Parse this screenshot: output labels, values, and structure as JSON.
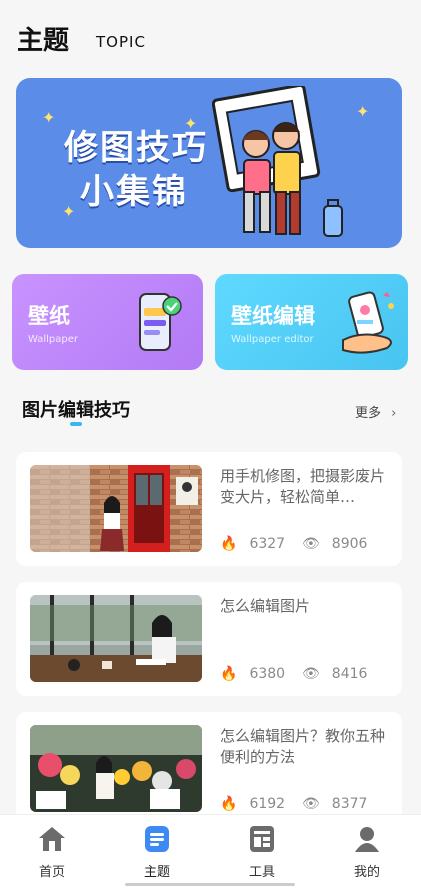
{
  "header": {
    "title": "主题",
    "subtitle": "TOPIC"
  },
  "banner": {
    "line1": "修图技巧",
    "line2": "小集锦"
  },
  "cards": [
    {
      "title": "壁纸",
      "subtitle": "Wallpaper",
      "color": "#b97ef7"
    },
    {
      "title": "壁纸编辑",
      "subtitle": "Wallpaper editor",
      "color": "#4fcaf3"
    }
  ],
  "section": {
    "title": "图片编辑技巧",
    "more": "更多"
  },
  "articles": [
    {
      "title": "用手机修图，把摄影废片变大片，轻松简单…",
      "likes": "6327",
      "views": "8906"
    },
    {
      "title": "怎么编辑图片",
      "likes": "6380",
      "views": "8416"
    },
    {
      "title": "怎么编辑图片？教你五种便利的方法",
      "likes": "6192",
      "views": "8377"
    }
  ],
  "tabs": [
    {
      "label": "首页",
      "icon": "home-icon"
    },
    {
      "label": "主题",
      "icon": "topic-icon"
    },
    {
      "label": "工具",
      "icon": "tools-icon"
    },
    {
      "label": "我的",
      "icon": "profile-icon"
    }
  ],
  "colors": {
    "accent": "#39b8f0",
    "banner": "#5b8de8"
  }
}
